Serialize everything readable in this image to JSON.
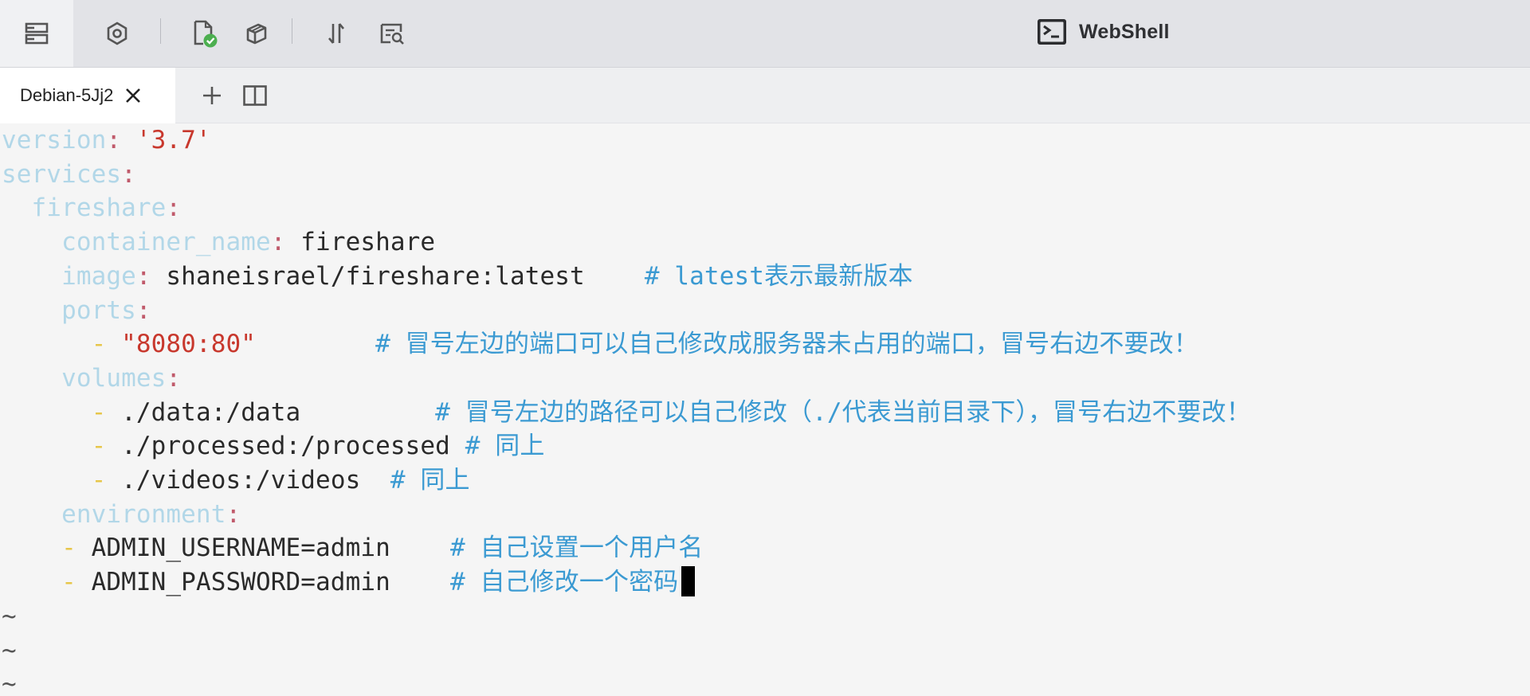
{
  "app": {
    "title": "WebShell"
  },
  "toolbar": {
    "buttons": [
      {
        "name": "server-list",
        "icon": "server-list-icon",
        "active": true
      },
      {
        "name": "settings",
        "icon": "gear-icon"
      },
      {
        "name": "file-verified",
        "icon": "file-check-icon"
      },
      {
        "name": "package",
        "icon": "package-icon"
      },
      {
        "name": "transfer",
        "icon": "transfer-icon"
      },
      {
        "name": "log-search",
        "icon": "log-search-icon"
      }
    ]
  },
  "tabs": [
    {
      "label": "Debian-5Jj2",
      "active": true
    }
  ],
  "terminal": {
    "lines": [
      {
        "indent": "",
        "key": "version",
        "colon": ":",
        "string": "'3.7'"
      },
      {
        "indent": "",
        "key": "services",
        "colon": ":"
      },
      {
        "indent": "  ",
        "key": "fireshare",
        "colon": ":"
      },
      {
        "indent": "    ",
        "key": "container_name",
        "colon": ":",
        "value": "fireshare"
      },
      {
        "indent": "    ",
        "key": "image",
        "colon": ":",
        "value": "shaneisrael/fireshare:latest",
        "gap": "    ",
        "comment": "# latest表示最新版本"
      },
      {
        "indent": "    ",
        "key": "ports",
        "colon": ":"
      },
      {
        "indent": "      ",
        "dash": "-",
        "string": "\"8080:80\"",
        "gap": "        ",
        "comment": "# 冒号左边的端口可以自己修改成服务器未占用的端口，冒号右边不要改！"
      },
      {
        "indent": "    ",
        "key": "volumes",
        "colon": ":"
      },
      {
        "indent": "      ",
        "dash": "-",
        "value": "./data:/data",
        "gap": "         ",
        "comment": "# 冒号左边的路径可以自己修改（./代表当前目录下），冒号右边不要改！"
      },
      {
        "indent": "      ",
        "dash": "-",
        "value": "./processed:/processed",
        "gap": " ",
        "comment": "# 同上"
      },
      {
        "indent": "      ",
        "dash": "-",
        "value": "./videos:/videos",
        "gap": "  ",
        "comment": "# 同上"
      },
      {
        "indent": "    ",
        "key": "environment",
        "colon": ":"
      },
      {
        "indent": "    ",
        "dash": "-",
        "value": "ADMIN_USERNAME=admin",
        "gap": "    ",
        "comment": "# 自己设置一个用户名"
      },
      {
        "indent": "    ",
        "dash": "-",
        "value": "ADMIN_PASSWORD=admin",
        "gap": "    ",
        "comment": "# 自己修改一个密码",
        "cursor": true
      },
      {
        "tilde": "~"
      },
      {
        "tilde": "~"
      },
      {
        "tilde": "~"
      }
    ]
  },
  "colors": {
    "key": "#b2d7e8",
    "colon": "#c05a6b",
    "string": "#c8382d",
    "value": "#2a2a2a",
    "comment": "#3b9ad2",
    "dash": "#e7c64a",
    "toolbar_bg": "#e2e3e7",
    "terminal_bg": "#f5f5f5",
    "check_badge": "#4caf50"
  }
}
